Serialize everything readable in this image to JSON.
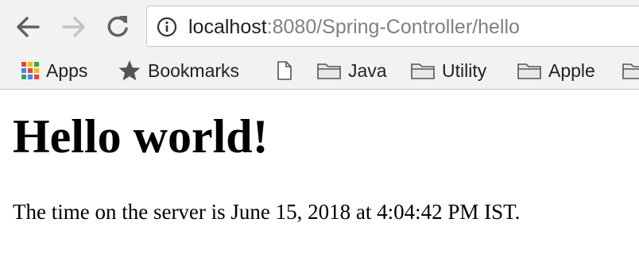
{
  "browser": {
    "address_bar": {
      "host": "localhost",
      "rest": ":8080/Spring-Controller/hello"
    },
    "bookmarks": [
      {
        "label": "Apps",
        "icon": "apps-grid-icon"
      },
      {
        "label": "Bookmarks",
        "icon": "star-icon"
      },
      {
        "label": "",
        "icon": "page-icon"
      },
      {
        "label": "Java",
        "icon": "folder-icon"
      },
      {
        "label": "Utility",
        "icon": "folder-icon"
      },
      {
        "label": "Apple",
        "icon": "folder-icon"
      }
    ]
  },
  "page": {
    "heading": "Hello world!",
    "message": "The time on the server is June 15, 2018 at 4:04:42 PM IST."
  }
}
